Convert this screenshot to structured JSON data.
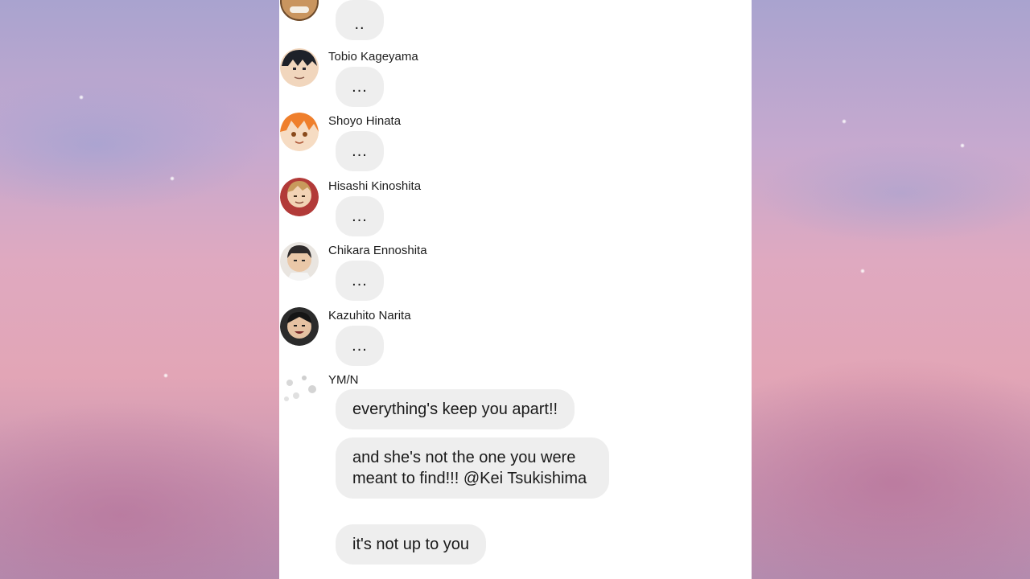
{
  "messages": [
    {
      "name": "",
      "text": ".."
    },
    {
      "name": "Tobio Kageyama",
      "text": "..."
    },
    {
      "name": "Shoyo Hinata",
      "text": "..."
    },
    {
      "name": "Hisashi Kinoshita",
      "text": "..."
    },
    {
      "name": "Chikara Ennoshita",
      "text": "..."
    },
    {
      "name": "Kazuhito Narita",
      "text": "..."
    }
  ],
  "ymn": {
    "name": "YM/N",
    "bubbles": [
      "everything's keep you apart!!",
      "and she's not the one you were meant to find!!! @Kei Tsukishima",
      "it's not up to you"
    ]
  }
}
